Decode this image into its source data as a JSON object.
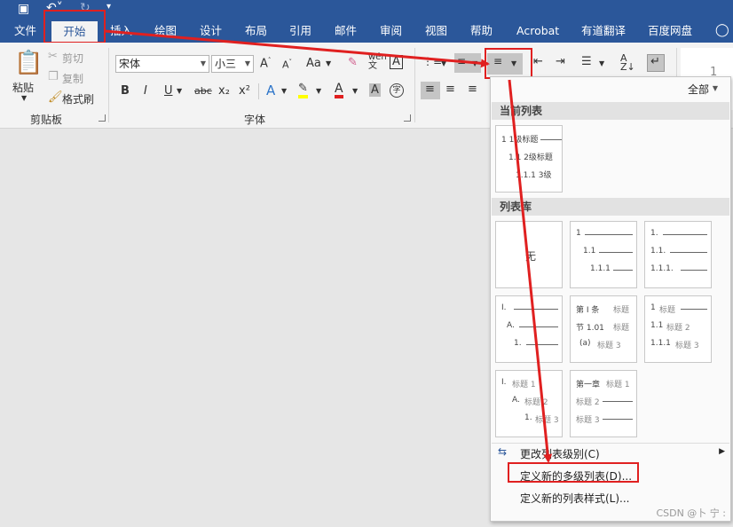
{
  "tabs": [
    "文件",
    "开始",
    "插入",
    "绘图",
    "设计",
    "布局",
    "引用",
    "邮件",
    "审阅",
    "视图",
    "帮助",
    "Acrobat",
    "有道翻译",
    "百度网盘"
  ],
  "clipboard": {
    "paste": "粘贴",
    "cut": "剪切",
    "copy": "复制",
    "format_painter": "格式刷",
    "group_label": "剪贴板"
  },
  "font": {
    "name": "宋体",
    "size": "小三",
    "change_case": "Aa",
    "group_label": "字体",
    "bold": "B",
    "italic": "I",
    "underline": "U",
    "strike": "abc",
    "sub": "x₂",
    "sup": "x²",
    "char_border": "A",
    "text_effect": "A",
    "font_color": "A",
    "char_shade": "A",
    "enclose": "字"
  },
  "paragraph": {
    "all_label": "全部"
  },
  "dropdown": {
    "current_list_header": "当前列表",
    "library_header": "列表库",
    "none_label": "无",
    "current_tile": [
      "1 1级标题",
      "1.1 2级标题",
      "1.1.1 3级"
    ],
    "tile_numbering": {
      "n1": "1",
      "n2": "1.1",
      "n3": "1.1.1",
      "d1": "1.",
      "d2": "1.1.",
      "d3": "1.1.1."
    },
    "tile_roman": {
      "a": "I.",
      "b": "A.",
      "c": "1."
    },
    "tile_chapter": {
      "a": "第 I 条",
      "a_t": "标题",
      "b": "节 1.01",
      "b_t": "标题",
      "c": "(a)",
      "c_t": "标题 3"
    },
    "tile_heading_num": {
      "a": "1",
      "a_t": "标题",
      "b": "1.1",
      "b_t": "标题 2",
      "c": "1.1.1",
      "c_t": "标题 3"
    },
    "tile_roman_heading": {
      "a": "I.",
      "a_t": "标题 1",
      "b": "A.",
      "b_t": "标题 2",
      "c": "1.",
      "c_t": "标题 3"
    },
    "tile_chapter2": {
      "a": "第一章",
      "a_t": "标题 1",
      "b": "标题 2",
      "c": "标题 3"
    },
    "menu": {
      "change_level": "更改列表级别(C)",
      "define_new_multilevel": "定义新的多级列表(D)...",
      "define_new_style": "定义新的列表样式(L)..."
    }
  },
  "watermark": "CSDN @卜 宁 :",
  "colors": {
    "title_blue": "#2b579a",
    "highlight_red": "#e02020"
  }
}
